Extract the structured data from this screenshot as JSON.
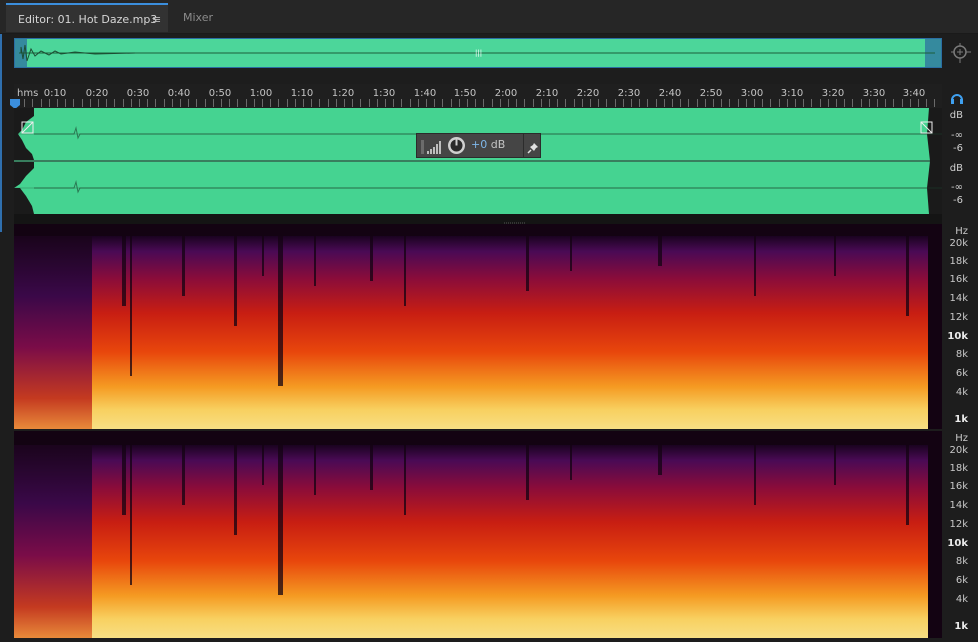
{
  "tabs": {
    "editor_label": "Editor: 01. Hot Daze.mp3",
    "editor_menu": "≡",
    "mixer_label": "Mixer"
  },
  "ruler": {
    "unit": "hms",
    "ticks": [
      "0:10",
      "0:20",
      "0:30",
      "0:40",
      "0:50",
      "1:00",
      "1:10",
      "1:20",
      "1:30",
      "1:40",
      "1:50",
      "2:00",
      "2:10",
      "2:20",
      "2:30",
      "2:40",
      "2:50",
      "3:00",
      "3:10",
      "3:20",
      "3:30",
      "3:40"
    ]
  },
  "hud": {
    "value": "+0",
    "unit": " dB"
  },
  "db_scale": {
    "ch1": [
      "dB",
      "-∞",
      "-6"
    ],
    "ch2": [
      "dB",
      "-∞",
      "-6"
    ]
  },
  "hz_scale": {
    "unit": "Hz",
    "labels": [
      "20k",
      "18k",
      "16k",
      "14k",
      "12k",
      "10k",
      "8k",
      "6k",
      "4k",
      "1k"
    ]
  },
  "colors": {
    "waveform": "#45d391",
    "accent": "#3b8edc",
    "hud_value": "#7fb7ea"
  },
  "icons": {
    "zoom": "zoom-icon",
    "playhead": "playhead-icon",
    "headphone": "headphone-icon",
    "pin": "pin-icon",
    "meter": "level-meter-icon",
    "knob": "volume-knob-icon"
  }
}
